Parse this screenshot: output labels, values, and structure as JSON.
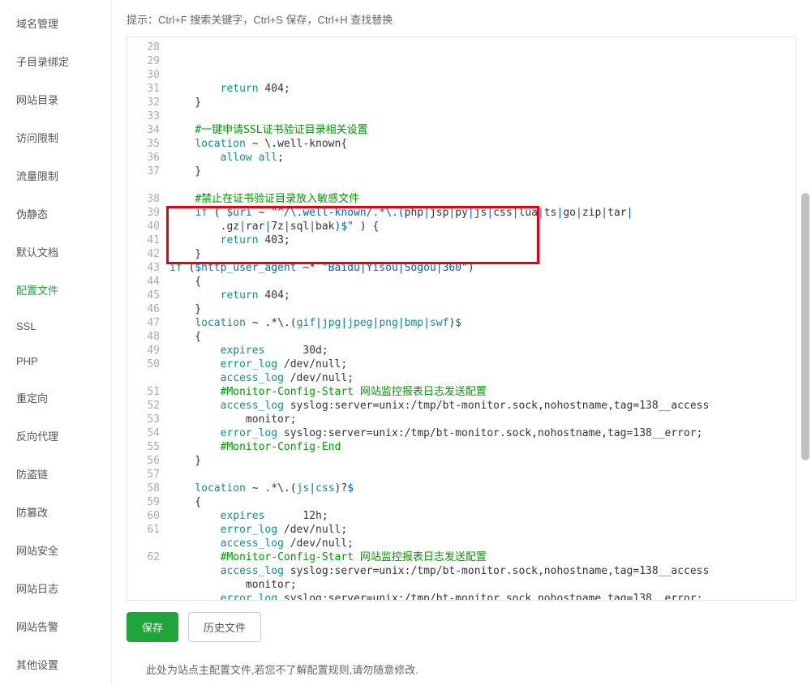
{
  "sidebar": {
    "items": [
      {
        "label": "域名管理"
      },
      {
        "label": "子目录绑定"
      },
      {
        "label": "网站目录"
      },
      {
        "label": "访问限制"
      },
      {
        "label": "流量限制"
      },
      {
        "label": "伪静态"
      },
      {
        "label": "默认文档"
      },
      {
        "label": "配置文件"
      },
      {
        "label": "SSL"
      },
      {
        "label": "PHP"
      },
      {
        "label": "重定向"
      },
      {
        "label": "反向代理"
      },
      {
        "label": "防盗链"
      },
      {
        "label": "防篡改"
      },
      {
        "label": "网站安全"
      },
      {
        "label": "网站日志"
      },
      {
        "label": "网站告警"
      },
      {
        "label": "其他设置"
      }
    ],
    "active_index": 7
  },
  "hint": "提示：Ctrl+F 搜索关键字，Ctrl+S 保存，Ctrl+H 查找替换",
  "buttons": {
    "save": "保存",
    "history": "历史文件"
  },
  "footer_note": "此处为站点主配置文件,若您不了解配置规则,请勿随意修改.",
  "comments": {
    "ssl_cert": "#一键申请SSL证书验证目录相关设置",
    "forbid_sensitive": "#禁止在证书验证目录放入敏感文件",
    "monitor_start": "#Monitor-Config-Start",
    "monitor_start_note": "网站监控报表日志发送配置",
    "monitor_end": "#Monitor-Config-End"
  },
  "code": {
    "ua_regex": "\"Baidu|Yisou|Sogou|360\"",
    "well_known_regex": "\"^/\\.well-known/.*\\.(php|jsp|py|js|css|lua|ts|go|zip|tar|.gz|rar|7z|sql|bak)$\"",
    "img_loc": ".*\\.(gif|jpg|jpeg|png|bmp|swf)$",
    "jscss_loc": ".*\\.(js|css)?$"
  },
  "line_start": 28,
  "line_end": 62
}
